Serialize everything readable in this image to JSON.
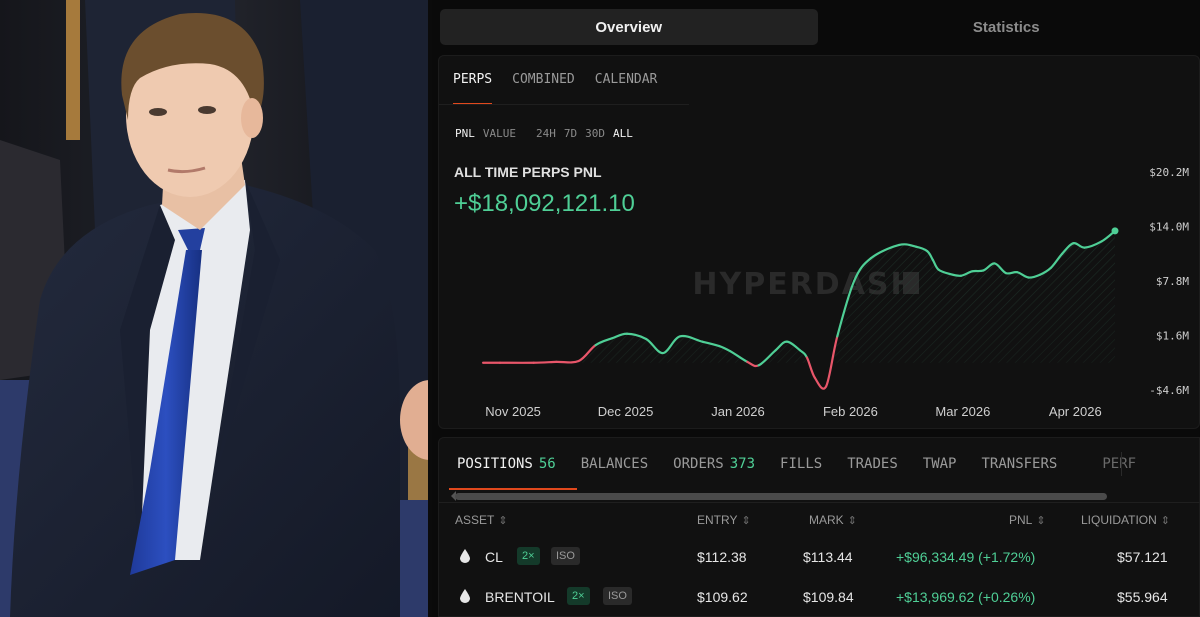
{
  "app": {
    "top_tabs": [
      "Overview",
      "Statistics"
    ],
    "active_top_tab": "Overview",
    "sub_tabs": [
      "PERPS",
      "COMBINED",
      "CALENDAR"
    ],
    "active_sub_tab": "PERPS",
    "metric_toggles": [
      "PNL",
      "VALUE"
    ],
    "range_toggles": [
      "24H",
      "7D",
      "30D",
      "ALL"
    ],
    "active_metric": "PNL",
    "active_range": "ALL",
    "pnl_title": "ALL TIME PERPS PNL",
    "pnl_value": "+$18,092,121.10",
    "watermark": "HYPERDASH",
    "colors": {
      "positive": "#4fcf96",
      "negative": "#e8566a",
      "accent": "#e1491d",
      "background": "#0a0a0a"
    }
  },
  "chart_data": {
    "type": "area",
    "x_ticks": [
      "Nov 2025",
      "Dec 2025",
      "Jan 2026",
      "Feb 2026",
      "Mar 2026",
      "Apr 2026"
    ],
    "y_ticks": [
      "$20.2M",
      "$14.0M",
      "$7.8M",
      "$1.6M",
      "-$4.6M"
    ],
    "ylim": [
      -4.6,
      20.2
    ],
    "y_unit": "$M",
    "grid": false,
    "series": [
      {
        "x": [
          0,
          0.15,
          0.45,
          0.65,
          0.85,
          1.0,
          1.15,
          1.28,
          1.45,
          1.6,
          1.75,
          1.95,
          2.1,
          2.2,
          2.35,
          2.45,
          2.6,
          2.7,
          2.82,
          2.88,
          2.95,
          3.05,
          3.15,
          3.3,
          3.45,
          3.7,
          3.85,
          3.95,
          4.0,
          4.05,
          4.15,
          4.25,
          4.35,
          4.45,
          4.55,
          4.65,
          4.75,
          4.85,
          4.95,
          5.05,
          5.15,
          5.25,
          5.35,
          5.5,
          5.62
        ],
        "y": [
          -1.5,
          -1.5,
          -1.5,
          -1.4,
          -1.3,
          0.5,
          1.3,
          1.8,
          1.2,
          -0.4,
          1.5,
          0.9,
          0.4,
          -0.2,
          -1.4,
          -1.8,
          -0.1,
          0.9,
          -0.1,
          -0.9,
          -3.2,
          -4.2,
          1.5,
          7.8,
          10.4,
          11.9,
          11.7,
          11.2,
          10.2,
          9.1,
          8.6,
          8.4,
          8.9,
          9.0,
          9.8,
          8.7,
          8.8,
          8.2,
          8.5,
          9.3,
          10.9,
          12.1,
          11.6,
          12.3,
          13.5
        ]
      }
    ]
  },
  "positions": {
    "tabs": [
      {
        "label": "POSITIONS",
        "count": "56"
      },
      {
        "label": "BALANCES",
        "count": ""
      },
      {
        "label": "ORDERS",
        "count": "373"
      },
      {
        "label": "FILLS",
        "count": ""
      },
      {
        "label": "TRADES",
        "count": ""
      },
      {
        "label": "TWAP",
        "count": ""
      },
      {
        "label": "TRANSFERS",
        "count": ""
      },
      {
        "label": "PERF",
        "count": ""
      }
    ],
    "columns": {
      "asset": "ASSET",
      "entry": "ENTRY",
      "mark": "MARK",
      "pnl": "PNL",
      "liquidation": "LIQUIDATION"
    },
    "rows": [
      {
        "asset": "CL",
        "leverage": "2×",
        "margin": "ISO",
        "entry": "$112.38",
        "mark": "$113.44",
        "pnl": "+$96,334.49 (+1.72%)",
        "liquidation": "$57.121"
      },
      {
        "asset": "BRENTOIL",
        "leverage": "2×",
        "margin": "ISO",
        "entry": "$109.62",
        "mark": "$109.84",
        "pnl": "+$13,969.62 (+0.26%)",
        "liquidation": "$55.964"
      }
    ]
  }
}
